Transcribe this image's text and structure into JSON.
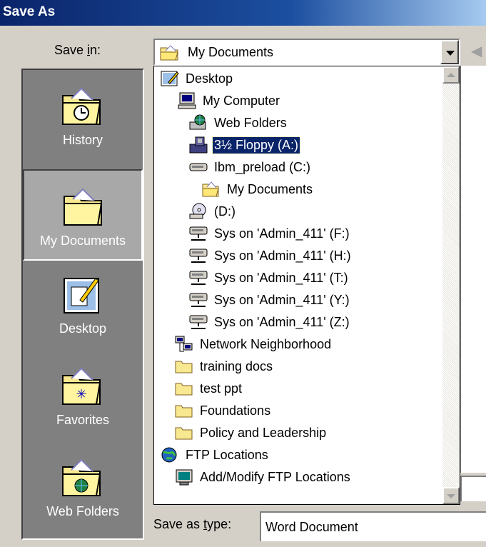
{
  "window": {
    "title": "Save As"
  },
  "save_in": {
    "label_pre": "Save ",
    "label_key": "i",
    "label_post": "n:",
    "value": "My Documents"
  },
  "places_bar": [
    {
      "label": "History",
      "icon": "history-icon",
      "selected": false
    },
    {
      "label": "My Documents",
      "icon": "my-documents-icon",
      "selected": true
    },
    {
      "label": "Desktop",
      "icon": "desktop-icon",
      "selected": false
    },
    {
      "label": "Favorites",
      "icon": "favorites-icon",
      "selected": false
    },
    {
      "label": "Web Folders",
      "icon": "web-folders-icon",
      "selected": false
    }
  ],
  "locations": [
    {
      "label": "Desktop",
      "icon": "desktop-icon"
    },
    {
      "label": "My Computer",
      "icon": "computer-icon"
    },
    {
      "label": "Web Folders",
      "icon": "web-folders-icon"
    },
    {
      "label": "3½ Floppy (A:)",
      "icon": "floppy-icon",
      "highlighted": true
    },
    {
      "label": "Ibm_preload (C:)",
      "icon": "hard-drive-icon"
    },
    {
      "label": "My Documents",
      "icon": "my-documents-icon"
    },
    {
      "label": "(D:)",
      "icon": "cd-drive-icon"
    },
    {
      "label": "Sys on 'Admin_411' (F:)",
      "icon": "network-drive-icon"
    },
    {
      "label": "Sys on 'Admin_411' (H:)",
      "icon": "network-drive-icon"
    },
    {
      "label": "Sys on 'Admin_411' (T:)",
      "icon": "network-drive-icon"
    },
    {
      "label": "Sys on 'Admin_411' (Y:)",
      "icon": "network-drive-icon"
    },
    {
      "label": "Sys on 'Admin_411' (Z:)",
      "icon": "network-drive-icon"
    },
    {
      "label": "Network Neighborhood",
      "icon": "network-neighborhood-icon"
    },
    {
      "label": "training docs",
      "icon": "folder-icon"
    },
    {
      "label": "test ppt",
      "icon": "folder-icon"
    },
    {
      "label": "Foundations",
      "icon": "folder-icon"
    },
    {
      "label": "Policy and Leadership",
      "icon": "folder-icon"
    },
    {
      "label": "FTP Locations",
      "icon": "ftp-locations-icon"
    },
    {
      "label": "Add/Modify FTP Locations",
      "icon": "ftp-add-icon"
    }
  ],
  "save_as_type": {
    "label_pre": "Save as ",
    "label_key": "t",
    "label_post": "ype:",
    "value": "Word Document"
  }
}
